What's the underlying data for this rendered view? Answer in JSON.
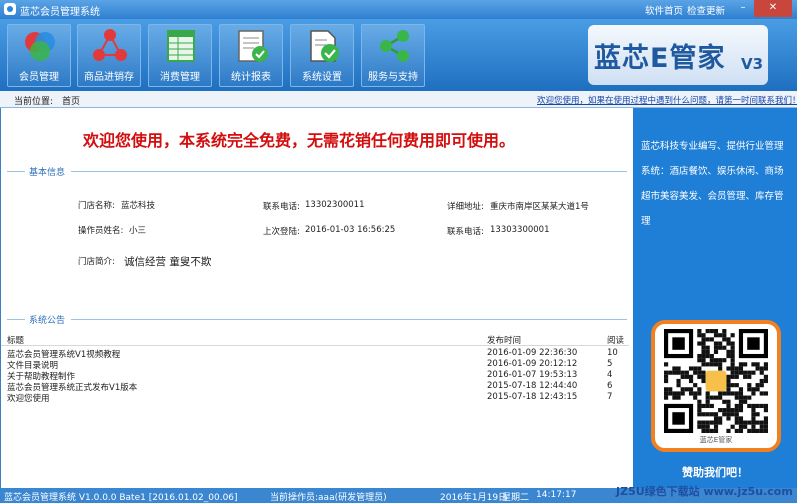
{
  "window": {
    "title": "蓝芯会员管理系统",
    "link_home": "软件首页",
    "link_update": "检查更新"
  },
  "toolbar": {
    "buttons": [
      {
        "label": "会员管理"
      },
      {
        "label": "商品进销存"
      },
      {
        "label": "消费管理"
      },
      {
        "label": "统计报表"
      },
      {
        "label": "系统设置"
      },
      {
        "label": "服务与支持"
      }
    ]
  },
  "brand": {
    "name": "蓝芯E管家",
    "version": "V3"
  },
  "location": {
    "label": "当前位置:",
    "value": "首页",
    "message": "欢迎您使用，如果在使用过程中遇到什么问题，请第一时间联系我们！"
  },
  "welcome": "欢迎您使用，本系统完全免费，无需花销任何费用即可使用。",
  "basic": {
    "title": "基本信息",
    "store_name_label": "门店名称:",
    "store_name": "蓝芯科技",
    "phone_label": "联系电话:",
    "phone": "13302300011",
    "address_label": "详细地址:",
    "address": "重庆市南岸区某某大道1号",
    "operator_label": "操作员姓名:",
    "operator": "小三",
    "lastlogin_label": "上次登陆:",
    "lastlogin": "2016-01-03 16:56:25",
    "phone2_label": "联系电话:",
    "phone2": "13303300001",
    "intro_label": "门店简介:",
    "intro": "诚信经营 童叟不欺"
  },
  "announce": {
    "title": "系统公告",
    "col_title": "标题",
    "col_time": "发布时间",
    "col_reads": "阅读",
    "rows": [
      {
        "title": "蓝芯会员管理系统V1视频教程",
        "time": "2016-01-09 22:36:30",
        "reads": "10"
      },
      {
        "title": "文件目录说明",
        "time": "2016-01-09 20:12:12",
        "reads": "5"
      },
      {
        "title": "关于帮助教程制作",
        "time": "2016-01-07 19:53:13",
        "reads": "4"
      },
      {
        "title": "蓝芯会员管理系统正式发布V1版本",
        "time": "2015-07-18 12:44:40",
        "reads": "6"
      },
      {
        "title": "欢迎您使用",
        "time": "2015-07-18 12:43:15",
        "reads": "7"
      }
    ]
  },
  "sidebar": {
    "intro": "蓝芯科技专业编写、提供行业管理系统：酒店餐饮、娱乐休闲、商场超市美容美发、会员管理、库存管理",
    "qr_caption": "蓝芯E管家",
    "follow": "赞助我们吧！"
  },
  "status": {
    "version": "蓝芯会员管理系统 V1.0.0.0 Bate1 [2016.01.02_00.06]",
    "operator": "当前操作员:aaa(研发管理员)",
    "date": "2016年1月19日",
    "weekday": "星期二",
    "time": "14:17:17"
  },
  "watermark": "JZ5U绿色下载站 www.jz5u.com",
  "colors": {
    "toolbar": "#2f7fd0",
    "accent_red": "#d30e0e",
    "sidebar": "#1f7ed6",
    "qr_border": "#f08020"
  },
  "icons": [
    "app-icon",
    "members-icon",
    "products-icon",
    "consumption-icon",
    "reports-icon",
    "settings-icon",
    "service-icon",
    "qr-code"
  ]
}
